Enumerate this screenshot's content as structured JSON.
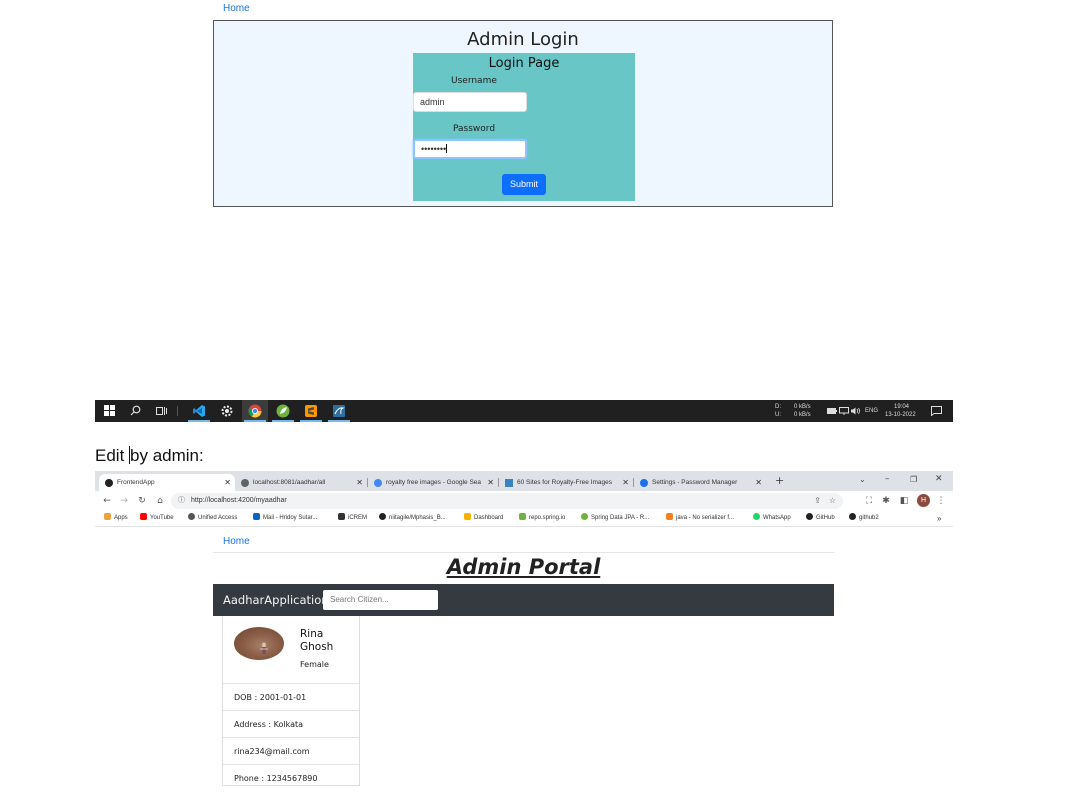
{
  "top": {
    "home_link": "Home",
    "admin_title": "Admin Login",
    "login_page_title": "Login Page",
    "username_label": "Username",
    "username_value": "admin",
    "password_label": "Password",
    "password_value": "••••••••",
    "submit_label": "Submit",
    "colors": {
      "frame_bg": "#eef6ff",
      "login_box_bg": "#68c6c6",
      "submit_bg": "#0d6efd"
    }
  },
  "taskbar": {
    "icons": [
      "windows-start-icon",
      "search-icon",
      "task-view-icon",
      "vscode-icon",
      "settings-gear-icon",
      "chrome-icon",
      "spring-icon",
      "sublime-icon",
      "mysql-icon"
    ],
    "net_down_label": "D:",
    "net_down_value": "0 kB/s",
    "net_up_label": "U:",
    "net_up_value": "0 kB/s",
    "language": "ENG",
    "time": "19:04",
    "date": "13-10-2022"
  },
  "caption": {
    "before_cursor": "Edit ",
    "after_cursor": "by admin:"
  },
  "browser": {
    "tabs": [
      {
        "label": "FrontendApp",
        "active": true
      },
      {
        "label": "localhost:8081/aadhar/all",
        "active": false
      },
      {
        "label": "royalty free images - Google Sea",
        "active": false
      },
      {
        "label": "60 Sites for Royalty-Free Images",
        "active": false
      },
      {
        "label": "Settings - Password Manager",
        "active": false
      }
    ],
    "url": "http://localhost:4200/myaadhar",
    "profile_initial": "H",
    "bookmarks": [
      "Apps",
      "YouTube",
      "Unified Access",
      "Mail - Hridoy Sutar...",
      "iCREM",
      "niitagile/Mphasis_B...",
      "Dashboard",
      "repo.spring.io",
      "Spring Data JPA - R...",
      "java - No serializer f...",
      "WhatsApp",
      "GitHub",
      "github2"
    ],
    "bookmarks_more": "»"
  },
  "portal": {
    "home_link": "Home",
    "title": "Admin Portal",
    "brand": "AadharApplication",
    "search_placeholder": "Search Citizen...",
    "citizen": {
      "first_name": "Rina",
      "last_name": "Ghosh",
      "gender": "Female",
      "dob": "DOB : 2001-01-01",
      "address": "Address : Kolkata",
      "email": "rina234@mail.com",
      "phone": "Phone : 1234567890"
    }
  }
}
